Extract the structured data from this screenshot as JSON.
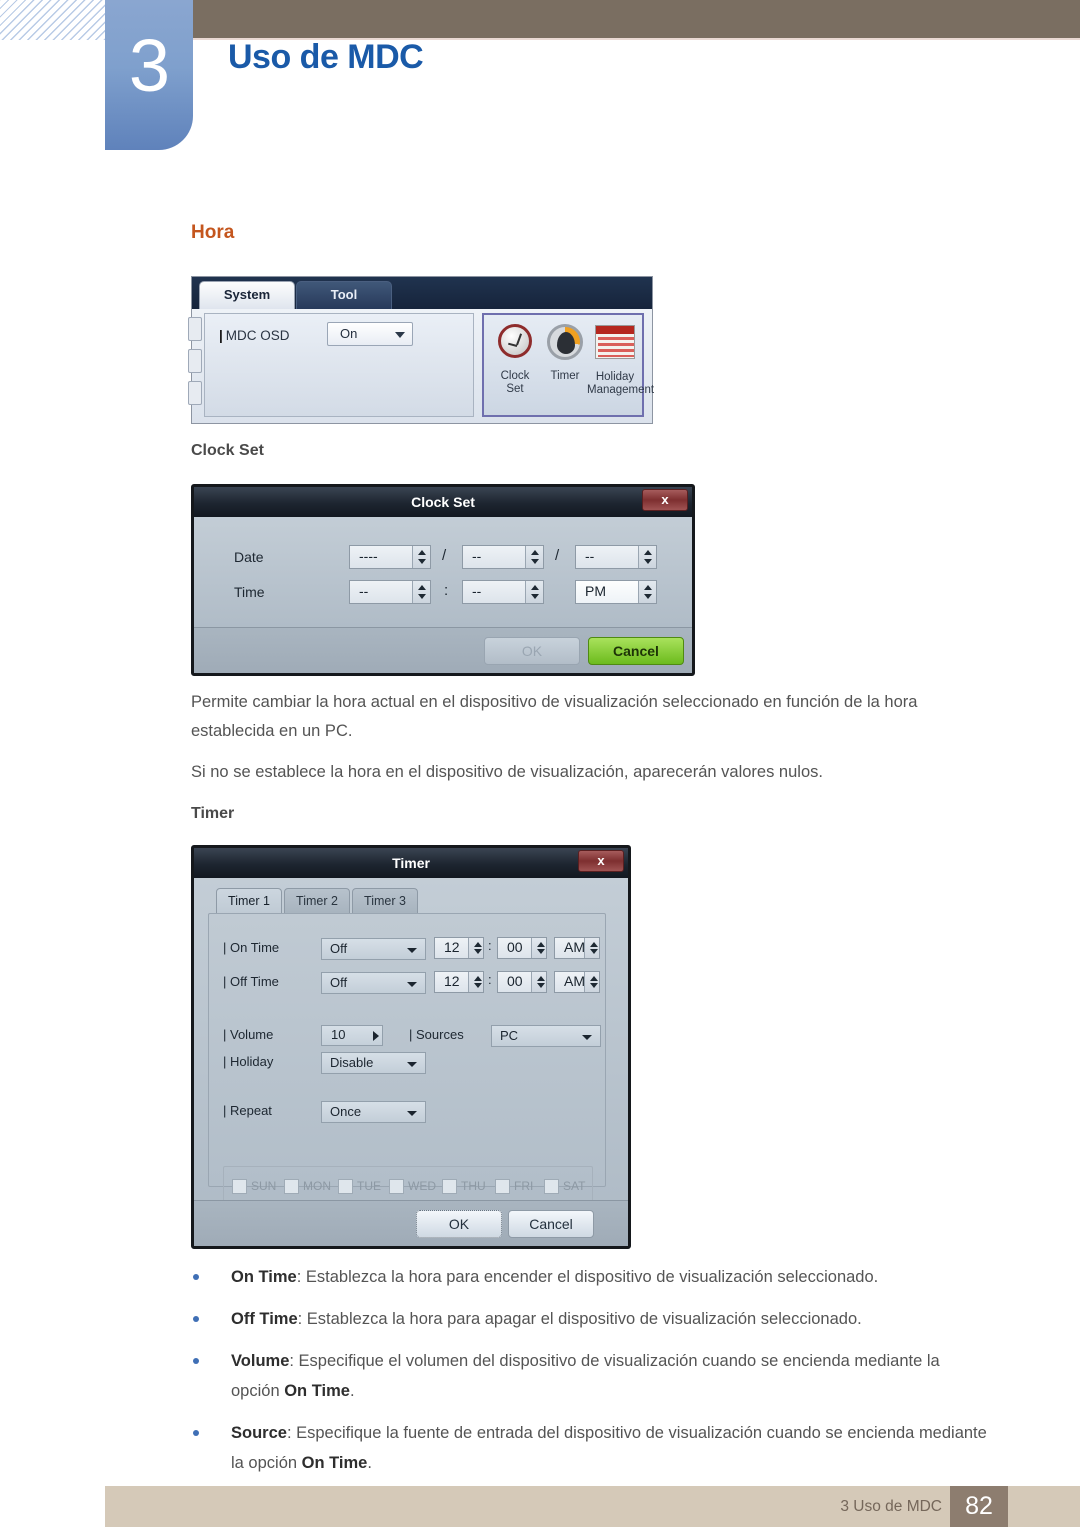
{
  "header": {
    "chapter_number": "3",
    "chapter_title": "Uso de MDC"
  },
  "sections": {
    "hora_heading": "Hora",
    "clock_set_heading": "Clock Set",
    "timer_heading": "Timer"
  },
  "paragraphs": {
    "p1": "Permite cambiar la hora actual en el dispositivo de visualización seleccionado en función de la hora establecida en un PC.",
    "p2": "Si no se establece la hora en el dispositivo de visualización, aparecerán valores nulos."
  },
  "system_panel": {
    "tabs": [
      {
        "label": "System",
        "active": true
      },
      {
        "label": "Tool",
        "active": false
      }
    ],
    "osd_label": "MDC OSD",
    "osd_value": "On",
    "icons": [
      {
        "name": "clock-set-icon",
        "line1": "Clock",
        "line2": "Set"
      },
      {
        "name": "timer-icon",
        "line1": "Timer",
        "line2": ""
      },
      {
        "name": "holiday-management-icon",
        "line1": "Holiday",
        "line2": "Management"
      }
    ]
  },
  "clock_set_dialog": {
    "title": "Clock Set",
    "close_label": "x",
    "date_label": "Date",
    "time_label": "Time",
    "date_year": "----",
    "date_month": "--",
    "date_day": "--",
    "time_hour": "--",
    "time_minute": "--",
    "time_meridiem": "PM",
    "separator_slash": "/",
    "separator_colon": ":",
    "ok_label": "OK",
    "cancel_label": "Cancel"
  },
  "timer_dialog": {
    "title": "Timer",
    "close_label": "x",
    "tabs": [
      {
        "label": "Timer 1",
        "active": true
      },
      {
        "label": "Timer 2",
        "active": false
      },
      {
        "label": "Timer 3",
        "active": false
      }
    ],
    "on_time_label": "On Time",
    "on_time_mode": "Off",
    "on_time_hour": "12",
    "on_time_minute": "00",
    "on_time_meridiem": "AM",
    "off_time_label": "Off Time",
    "off_time_mode": "Off",
    "off_time_hour": "12",
    "off_time_minute": "00",
    "off_time_meridiem": "AM",
    "volume_label": "Volume",
    "volume_value": "10",
    "sources_label": "Sources",
    "sources_value": "PC",
    "holiday_label": "Holiday",
    "holiday_value": "Disable",
    "repeat_label": "Repeat",
    "repeat_value": "Once",
    "days": [
      "SUN",
      "MON",
      "TUE",
      "WED",
      "THU",
      "FRI",
      "SAT"
    ],
    "ok_label": "OK",
    "cancel_label": "Cancel",
    "separator_colon": ":"
  },
  "bullets": [
    {
      "term": "On Time",
      "text": ": Establezca la hora para encender el dispositivo de visualización seleccionado."
    },
    {
      "term": "Off Time",
      "text": ": Establezca la hora para apagar el dispositivo de visualización seleccionado."
    },
    {
      "term": "Volume",
      "text": ": Especifique el volumen del dispositivo de visualización cuando se encienda mediante la opción ",
      "term2": "On Time",
      "text2": "."
    },
    {
      "term": "Source",
      "text": ": Especifique la fuente de entrada del dispositivo de visualización cuando se encienda mediante la opción ",
      "term2": "On Time",
      "text2": "."
    }
  ],
  "footer": {
    "label": "3 Uso de MDC",
    "page_number": "82"
  },
  "colors": {
    "header_brown": "#7a6e61",
    "chapter_blue": "#1a5aa8",
    "heading_orange": "#c4561e",
    "footer_beige": "#d5c9b8",
    "footer_page_brown": "#8d7d6f",
    "bullet_blue": "#3f6fb5"
  }
}
